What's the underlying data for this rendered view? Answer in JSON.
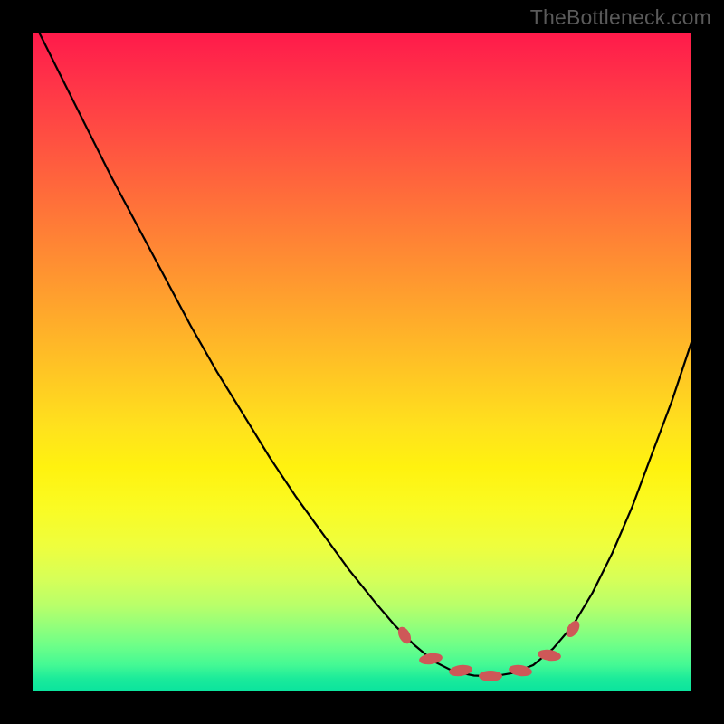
{
  "watermark": "TheBottleneck.com",
  "chart_data": {
    "type": "line",
    "title": "",
    "xlabel": "",
    "ylabel": "",
    "xlim": [
      0,
      100
    ],
    "ylim": [
      0,
      100
    ],
    "series": [
      {
        "name": "curve",
        "color": "#000000",
        "points": [
          {
            "x": 1,
            "y": 100
          },
          {
            "x": 4,
            "y": 94
          },
          {
            "x": 8,
            "y": 86
          },
          {
            "x": 12,
            "y": 78
          },
          {
            "x": 16,
            "y": 70.5
          },
          {
            "x": 20,
            "y": 63
          },
          {
            "x": 24,
            "y": 55.5
          },
          {
            "x": 28,
            "y": 48.5
          },
          {
            "x": 32,
            "y": 42
          },
          {
            "x": 36,
            "y": 35.5
          },
          {
            "x": 40,
            "y": 29.5
          },
          {
            "x": 44,
            "y": 24
          },
          {
            "x": 48,
            "y": 18.5
          },
          {
            "x": 52,
            "y": 13.5
          },
          {
            "x": 55,
            "y": 10
          },
          {
            "x": 58,
            "y": 7
          },
          {
            "x": 61,
            "y": 4.5
          },
          {
            "x": 64,
            "y": 3
          },
          {
            "x": 67,
            "y": 2.4
          },
          {
            "x": 70,
            "y": 2.3
          },
          {
            "x": 73,
            "y": 2.8
          },
          {
            "x": 76,
            "y": 4
          },
          {
            "x": 79,
            "y": 6.5
          },
          {
            "x": 82,
            "y": 10
          },
          {
            "x": 85,
            "y": 15
          },
          {
            "x": 88,
            "y": 21
          },
          {
            "x": 91,
            "y": 28
          },
          {
            "x": 94,
            "y": 36
          },
          {
            "x": 97,
            "y": 44
          },
          {
            "x": 100,
            "y": 53
          }
        ]
      }
    ],
    "markers": [
      {
        "x": 56.5,
        "y": 8.5,
        "orient": "v"
      },
      {
        "x": 60.5,
        "y": 5,
        "orient": "h"
      },
      {
        "x": 65,
        "y": 3.1,
        "orient": "h"
      },
      {
        "x": 69.5,
        "y": 2.4,
        "orient": "h"
      },
      {
        "x": 74,
        "y": 3.2,
        "orient": "h"
      },
      {
        "x": 78.5,
        "y": 5.5,
        "orient": "h"
      },
      {
        "x": 82,
        "y": 9.5,
        "orient": "v"
      }
    ],
    "gradient": {
      "top": "#ff1a4a",
      "mid": "#ffe21d",
      "bottom": "#0ae49e"
    }
  }
}
